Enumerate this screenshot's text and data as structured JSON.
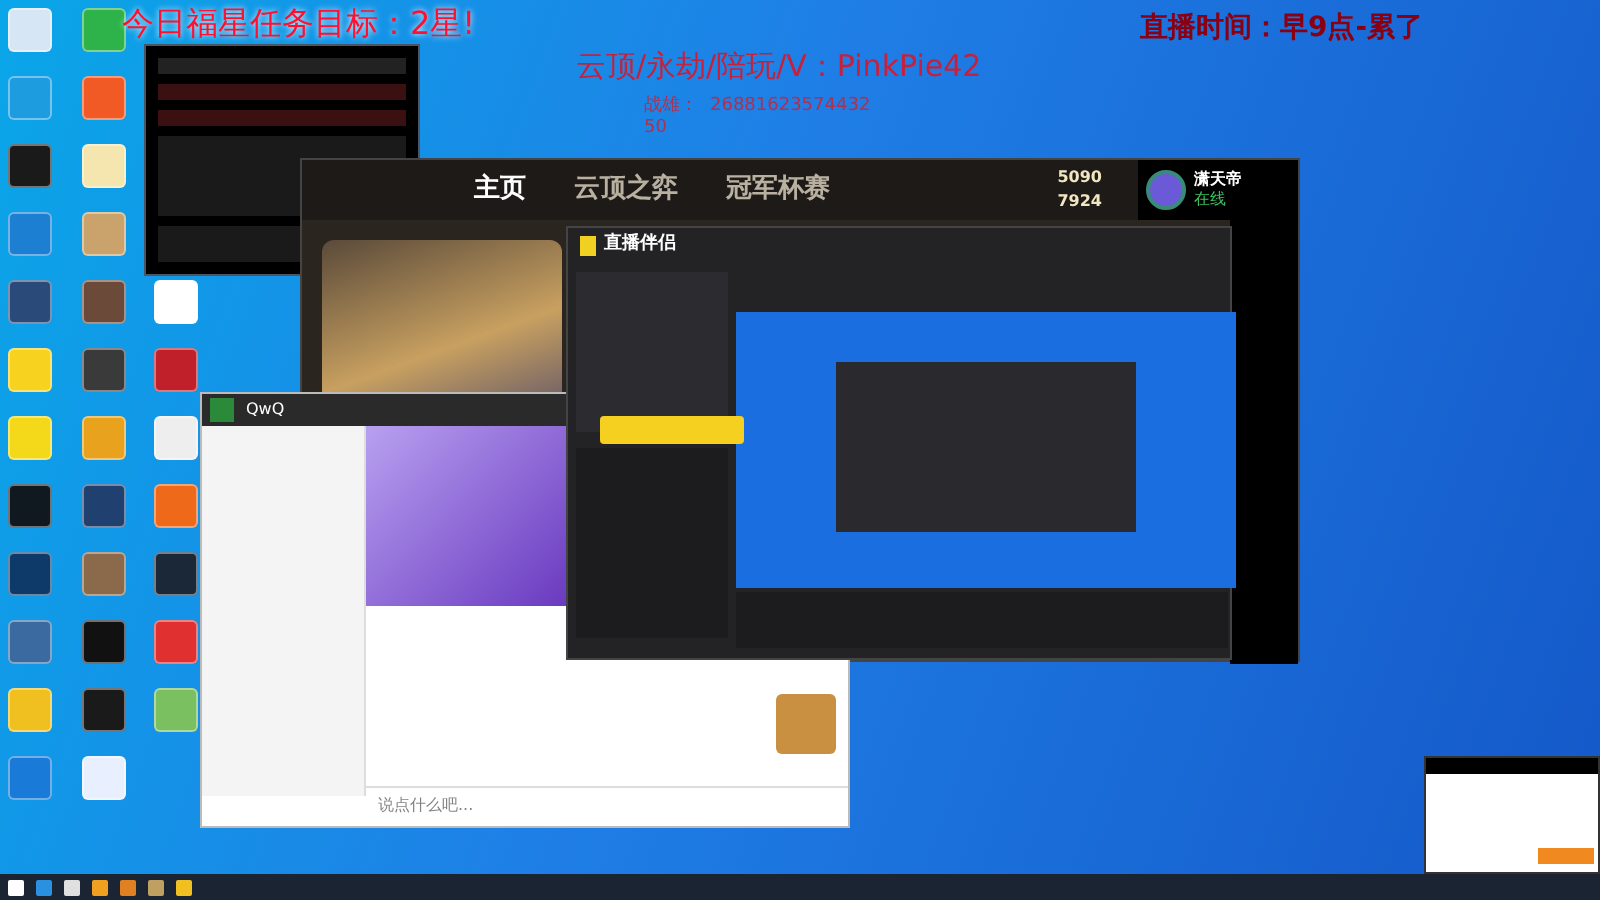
{
  "overlay_texts": {
    "goal": "今日福星任务目标：2星!",
    "services": "云顶/永劫/陪玩/V：PinkPie42",
    "id_label": "战雄：",
    "id_value": "26881623574432",
    "id_suffix": "50",
    "schedule": "直播时间：早9点-累了"
  },
  "game_client": {
    "tabs": [
      {
        "label": "主页",
        "selected": true
      },
      {
        "label": "云顶之弈",
        "selected": false
      },
      {
        "label": "冠军杯赛",
        "selected": false
      }
    ],
    "currency": [
      "5090",
      "7924"
    ],
    "player": {
      "name": "潇天帝",
      "status": "在线"
    }
  },
  "stream_app": {
    "title": "直播伴侣"
  },
  "chat": {
    "name": "QwQ",
    "placeholder": "说点什么吧..."
  }
}
